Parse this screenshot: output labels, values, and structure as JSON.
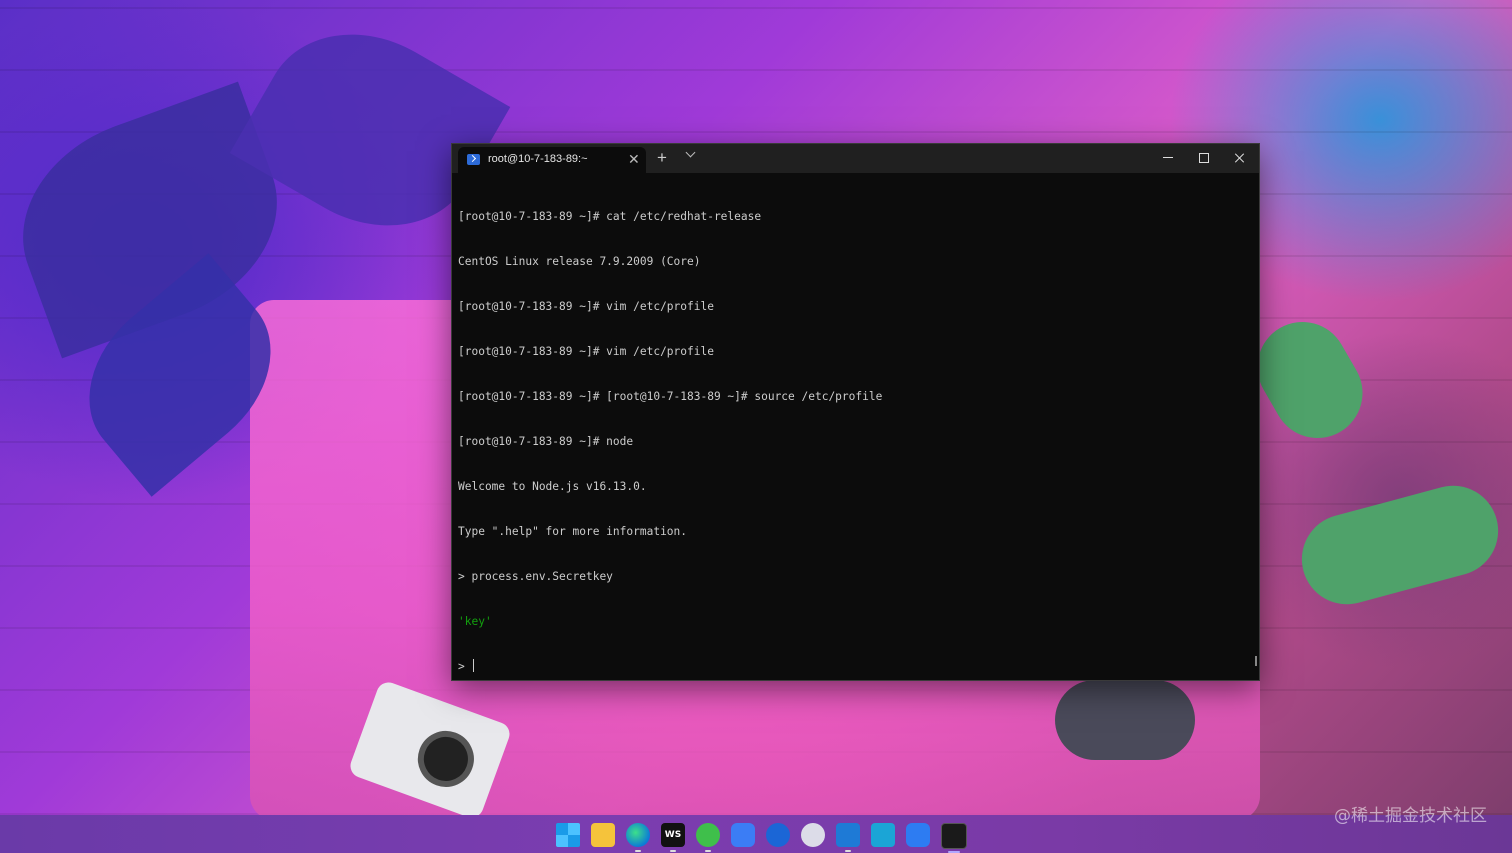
{
  "terminal": {
    "tab_title": "root@10-7-183-89:~",
    "tab_close_glyph": "✕",
    "new_tab_glyph": "+",
    "lines": [
      "[root@10-7-183-89 ~]# cat /etc/redhat-release",
      "CentOS Linux release 7.9.2009 (Core)",
      "[root@10-7-183-89 ~]# vim /etc/profile",
      "[root@10-7-183-89 ~]# vim /etc/profile",
      "[root@10-7-183-89 ~]# [root@10-7-183-89 ~]# source /etc/profile",
      "[root@10-7-183-89 ~]# node",
      "Welcome to Node.js v16.13.0.",
      "Type \".help\" for more information.",
      "> process.env.Secretkey"
    ],
    "output_value": "'key'",
    "prompt": "> ",
    "output_color": "#13a10e"
  },
  "taskbar": {
    "icons": [
      "windows-start-icon",
      "file-explorer-icon",
      "edge-browser-icon",
      "webstorm-icon",
      "wechat-icon",
      "feishu-icon",
      "maps-icon",
      "chat-icon",
      "vscode-icon",
      "translate-icon",
      "star-app-icon",
      "terminal-icon"
    ],
    "ws_label": "WS"
  },
  "watermark": "@稀土掘金技术社区"
}
